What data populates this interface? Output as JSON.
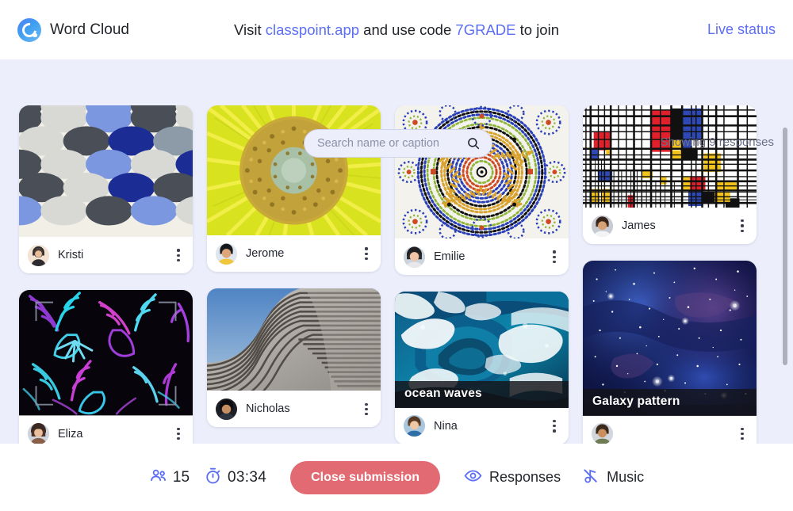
{
  "header": {
    "brand_title": "Word Cloud",
    "logo_icon": "classpoint-logo-icon",
    "join_prefix": "Visit ",
    "join_link": "classpoint.app",
    "join_middle": " and use code ",
    "join_code": "7GRADE",
    "join_suffix": " to join",
    "live_status": "Live status"
  },
  "toolbar": {
    "search_placeholder": "Search name or caption",
    "search_value": "",
    "search_icon": "search-icon",
    "showing": "Showing 9 responses"
  },
  "colors": {
    "accent": "#5b6ef5",
    "background": "#eceefb",
    "close_button": "#e26a72",
    "card": "#ffffff"
  },
  "responses": [
    {
      "name": "Kristi",
      "caption": "",
      "image": "blue-grey-felt-fish-scale-pattern",
      "column": 1
    },
    {
      "name": "Eliza",
      "caption": "",
      "image": "neon-tropical-leaves-pattern",
      "column": 1
    },
    {
      "name": "Jerome",
      "caption": "",
      "image": "yellow-sunflower-closeup",
      "column": 2
    },
    {
      "name": "Nicholas",
      "caption": "",
      "image": "wavy-concrete-architecture",
      "column": 2
    },
    {
      "name": "Emilie",
      "caption": "",
      "image": "moroccan-mosaic-star-pattern",
      "column": 3
    },
    {
      "name": "Nina",
      "caption": "ocean waves",
      "image": "crashing-ocean-wave",
      "column": 3
    },
    {
      "name": "James",
      "caption": "",
      "image": "mondrian-grid-composition",
      "column": 4
    },
    {
      "name": "",
      "caption": "Galaxy pattern",
      "image": "blue-galaxy-starfield",
      "column": 4
    }
  ],
  "bottombar": {
    "participants_icon": "people-icon",
    "participants_count": "15",
    "timer_icon": "stopwatch-icon",
    "timer": "03:34",
    "close_label": "Close submission",
    "responses_icon": "eye-icon",
    "responses_label": "Responses",
    "music_icon": "music-note-off-icon",
    "music_label": "Music"
  }
}
